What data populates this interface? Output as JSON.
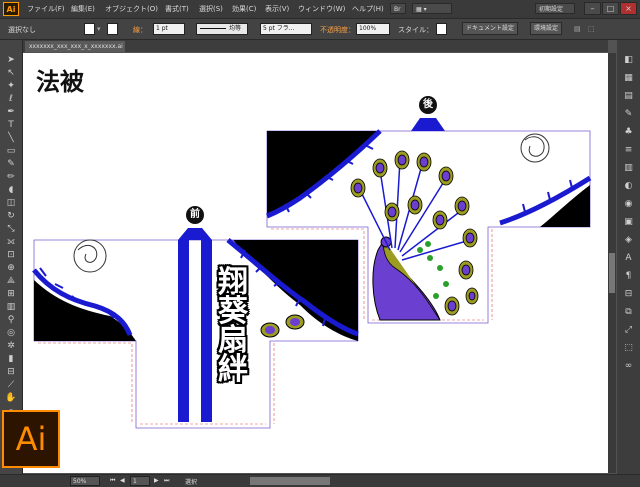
{
  "app": {
    "logo": "Ai"
  },
  "menu": [
    "ファイル(F)",
    "編集(E)",
    "オブジェクト(O)",
    "書式(T)",
    "選択(S)",
    "効果(C)",
    "表示(V)",
    "ウィンドウ(W)",
    "ヘルプ(H)"
  ],
  "workspace": {
    "label": "初期設定"
  },
  "control": {
    "selection": "選択なし",
    "stroke_label": "線：",
    "stroke_weight": "1 pt",
    "profile_label": "均等",
    "brush": "5 pt フラ...",
    "opacity_label": "不透明度：",
    "opacity": "100%",
    "style_label": "スタイル：",
    "doc_setup": "ドキュメント設定",
    "preferences": "環境設定"
  },
  "document": {
    "tab_title": "xxxxxxx_xxx_xxx_x_xxxxxxx.ai @"
  },
  "artwork": {
    "title": "法被",
    "front_label": "前",
    "back_label": "後",
    "vertical_chars": [
      "翔",
      "葵",
      "扇",
      "絆"
    ]
  },
  "status": {
    "zoom": "50%",
    "page": "1",
    "mode": "選択"
  },
  "colors": {
    "accent": "#ff9a00",
    "blue": "#1a1ad0",
    "purple": "#6b3fd0",
    "olive": "#9c9c22"
  }
}
